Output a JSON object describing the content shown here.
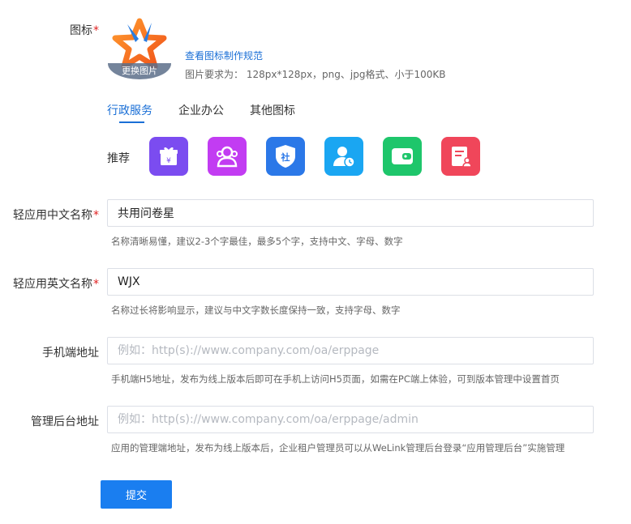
{
  "icon_field": {
    "label": "图标",
    "required_mark": "*",
    "change_button": "更换图片",
    "spec_link": "查看图标制作规范",
    "requirement": "图片要求为： 128px*128px，png、jpg格式、小于100KB"
  },
  "tabs": [
    {
      "label": "行政服务",
      "active": true
    },
    {
      "label": "企业办公",
      "active": false
    },
    {
      "label": "其他图标",
      "active": false
    }
  ],
  "recommend": {
    "label": "推荐",
    "icons": [
      {
        "name": "gift-money-icon",
        "color": "#7b4cf0"
      },
      {
        "name": "users-group-icon",
        "color": "#c23cf2"
      },
      {
        "name": "social-shield-icon",
        "color": "#2b78e8"
      },
      {
        "name": "user-clock-icon",
        "color": "#1aa6f2"
      },
      {
        "name": "wallet-icon",
        "color": "#1ec66b"
      },
      {
        "name": "form-user-icon",
        "color": "#f0465a"
      }
    ]
  },
  "cn_name": {
    "label": "轻应用中文名称",
    "required_mark": "*",
    "value": "共用问卷星",
    "hint": "名称清晰易懂，建议2-3个字最佳，最多5个字，支持中文、字母、数字"
  },
  "en_name": {
    "label": "轻应用英文名称",
    "required_mark": "*",
    "value": "WJX",
    "hint": "名称过长将影响显示，建议与中文字数长度保持一致，支持字母、数字"
  },
  "mobile_url": {
    "label": "手机端地址",
    "placeholder": "例如：http(s)://www.company.com/oa/erppage",
    "hint": "手机端H5地址，发布为线上版本后即可在手机上访问H5页面，如需在PC端上体验，可到版本管理中设置首页"
  },
  "admin_url": {
    "label": "管理后台地址",
    "placeholder": "例如：http(s)://www.company.com/oa/erppage/admin",
    "hint": "应用的管理端地址，发布为线上版本后，企业租户管理员可以从WeLink管理后台登录“应用管理后台”实施管理"
  },
  "submit_label": "提交"
}
